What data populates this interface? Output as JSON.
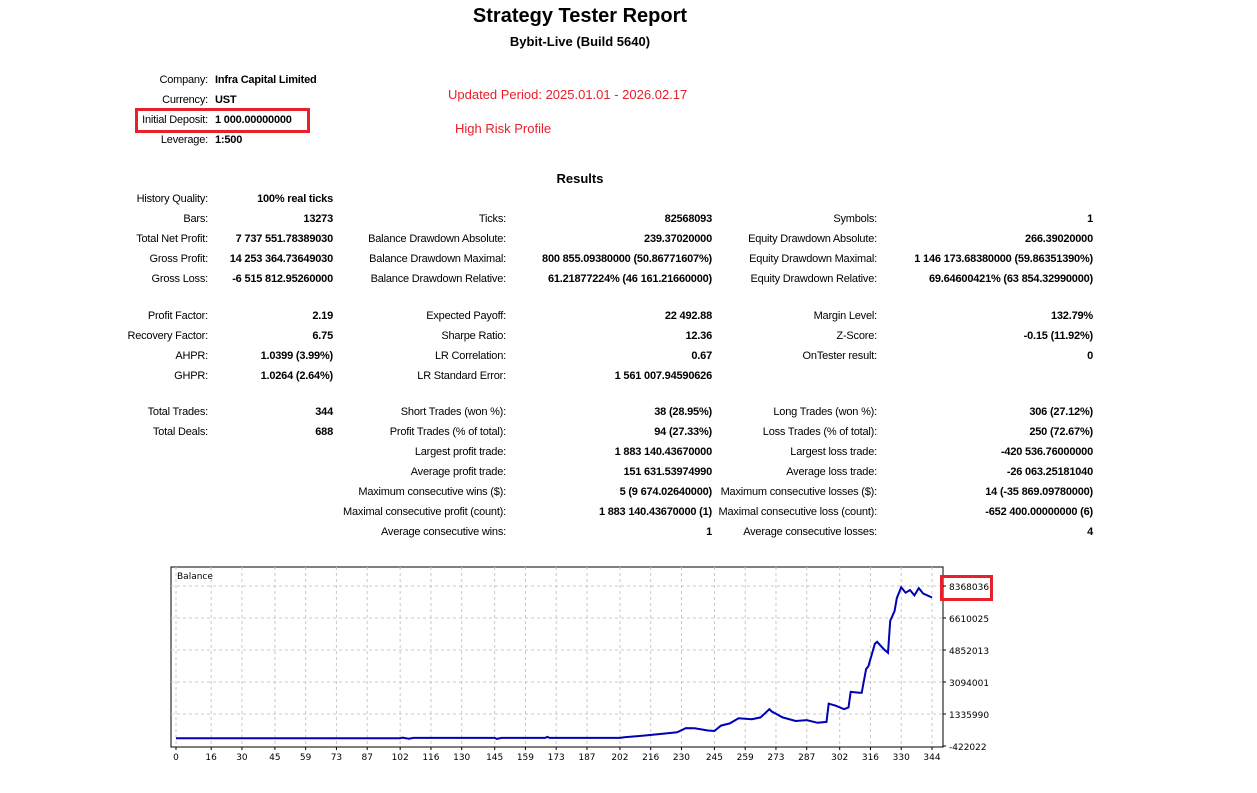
{
  "header": {
    "title": "Strategy Tester Report",
    "subtitle": "Bybit-Live (Build 5640)"
  },
  "info": [
    {
      "label": "Company:",
      "value": "Infra Capital Limited"
    },
    {
      "label": "Currency:",
      "value": "UST"
    },
    {
      "label": "Initial Deposit:",
      "value": "1 000.00000000"
    },
    {
      "label": "Leverage:",
      "value": "1:500"
    }
  ],
  "notes": {
    "period": "Updated Period: 2025.01.01 - 2026.02.17",
    "profile": "High Risk Profile"
  },
  "colors": {
    "highlight": "#e8202a",
    "balance_line": "#0000b4"
  },
  "results": {
    "title": "Results",
    "rows": [
      [
        "History Quality:",
        "100% real ticks",
        "",
        "",
        "",
        ""
      ],
      [
        "Bars:",
        "13273",
        "Ticks:",
        "82568093",
        "Symbols:",
        "1"
      ],
      [
        "Total Net Profit:",
        "7 737 551.78389030",
        "Balance Drawdown Absolute:",
        "239.37020000",
        "Equity Drawdown Absolute:",
        "266.39020000"
      ],
      [
        "Gross Profit:",
        "14 253 364.73649030",
        "Balance Drawdown Maximal:",
        "800 855.09380000 (50.86771607%)",
        "Equity Drawdown Maximal:",
        "1 146 173.68380000 (59.86351390%)"
      ],
      [
        "Gross Loss:",
        "-6 515 812.95260000",
        "Balance Drawdown Relative:",
        "61.21877224% (46 161.21660000)",
        "Equity Drawdown Relative:",
        "69.64600421% (63 854.32990000)"
      ],
      [
        "Profit Factor:",
        "2.19",
        "Expected Payoff:",
        "22 492.88",
        "Margin Level:",
        "132.79%"
      ],
      [
        "Recovery Factor:",
        "6.75",
        "Sharpe Ratio:",
        "12.36",
        "Z-Score:",
        "-0.15 (11.92%)"
      ],
      [
        "AHPR:",
        "1.0399 (3.99%)",
        "LR Correlation:",
        "0.67",
        "OnTester result:",
        "0"
      ],
      [
        "GHPR:",
        "1.0264 (2.64%)",
        "LR Standard Error:",
        "1 561 007.94590626",
        "",
        ""
      ],
      [
        "Total Trades:",
        "344",
        "Short Trades (won %):",
        "38 (28.95%)",
        "Long Trades (won %):",
        "306 (27.12%)"
      ],
      [
        "Total Deals:",
        "688",
        "Profit Trades (% of total):",
        "94 (27.33%)",
        "Loss Trades (% of total):",
        "250 (72.67%)"
      ],
      [
        "",
        "",
        "Largest profit trade:",
        "1 883 140.43670000",
        "Largest loss trade:",
        "-420 536.76000000"
      ],
      [
        "",
        "",
        "Average profit trade:",
        "151 631.53974990",
        "Average loss trade:",
        "-26 063.25181040"
      ],
      [
        "",
        "",
        "Maximum consecutive wins ($):",
        "5 (9 674.02640000)",
        "Maximum consecutive losses ($):",
        "14 (-35 869.09780000)"
      ],
      [
        "",
        "",
        "Maximal consecutive profit (count):",
        "1 883 140.43670000 (1)",
        "Maximal consecutive loss (count):",
        "-652 400.00000000 (6)"
      ],
      [
        "",
        "",
        "Average consecutive wins:",
        "1",
        "Average consecutive losses:",
        "4"
      ]
    ]
  },
  "chart_data": {
    "type": "line",
    "title": "Balance",
    "xlabel": "",
    "ylabel": "",
    "x_ticks": [
      "0",
      "16",
      "30",
      "45",
      "59",
      "73",
      "87",
      "102",
      "116",
      "130",
      "145",
      "159",
      "173",
      "187",
      "202",
      "216",
      "230",
      "245",
      "259",
      "273",
      "287",
      "302",
      "316",
      "330",
      "344"
    ],
    "y_ticks": [
      "8368036",
      "6610025",
      "4852013",
      "3094001",
      "1335990",
      "-422022"
    ],
    "highlighted_y_tick": "8368036",
    "xlim": [
      0,
      349
    ],
    "ylim": [
      -422022,
      8368036
    ],
    "grid": true,
    "series": [
      {
        "name": "Balance",
        "x": [
          0,
          102,
          103,
          106,
          108,
          145,
          146,
          148,
          168,
          169,
          170,
          202,
          204,
          214,
          222,
          228,
          232,
          236,
          242,
          245,
          248,
          252,
          256,
          262,
          266,
          270,
          271,
          276,
          282,
          287,
          292,
          296,
          297,
          300,
          304,
          306,
          307,
          311,
          312,
          314,
          315,
          318,
          319,
          322,
          324,
          325,
          327,
          328,
          330,
          332,
          334,
          336,
          338,
          340,
          344
        ],
        "y": [
          1000,
          1000,
          40000,
          -20000,
          25000,
          25000,
          -30000,
          25000,
          25000,
          80000,
          25000,
          25000,
          60000,
          160000,
          260000,
          330000,
          560000,
          550000,
          430000,
          400000,
          700000,
          820000,
          1100000,
          1050000,
          1150000,
          1600000,
          1480000,
          1150000,
          950000,
          1000000,
          850000,
          900000,
          1900000,
          1800000,
          1600000,
          1700000,
          2550000,
          2500000,
          2500000,
          3800000,
          3950000,
          5200000,
          5300000,
          4900000,
          4700000,
          6450000,
          7000000,
          7700000,
          8300000,
          8000000,
          8150000,
          7850000,
          8250000,
          7950000,
          7738552
        ]
      }
    ]
  }
}
